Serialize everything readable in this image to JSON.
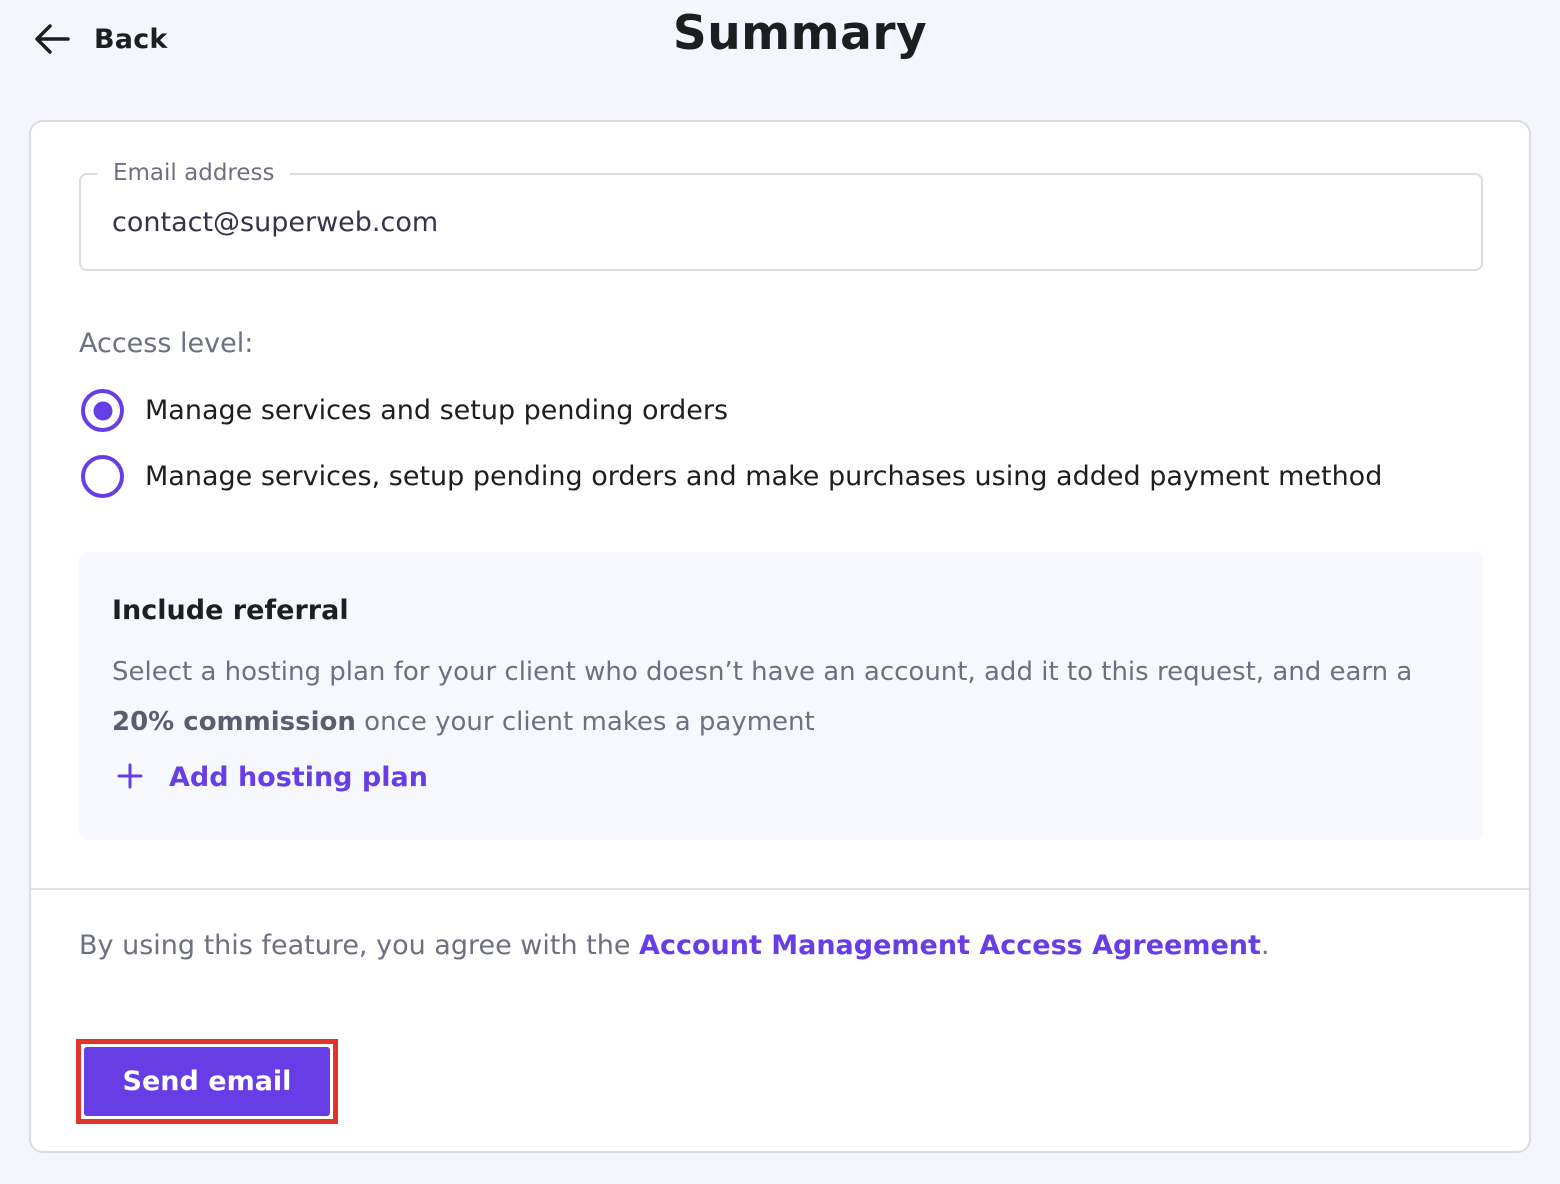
{
  "header": {
    "back_label": "Back",
    "title": "Summary"
  },
  "form": {
    "email": {
      "label": "Email address",
      "value": "contact@superweb.com"
    },
    "access": {
      "label": "Access level:",
      "options": [
        {
          "label": "Manage services and setup pending orders",
          "selected": true
        },
        {
          "label": "Manage services, setup pending orders and make purchases using added payment method",
          "selected": false
        }
      ]
    }
  },
  "referral": {
    "title": "Include referral",
    "text_before": "Select a hosting plan for your client who doesn’t have an account, add it to this request, and earn a ",
    "text_bold": "20% commission",
    "text_after": " once your client makes a payment",
    "add_label": "Add hosting plan"
  },
  "footer": {
    "agreement_prefix": "By using this feature, you agree with the ",
    "agreement_link": "Account Management Access Agreement",
    "agreement_suffix": ".",
    "send_label": "Send email"
  },
  "colors": {
    "accent": "#673de6",
    "highlight_border": "#e0352b",
    "background": "#f4f5fd"
  },
  "icons": {
    "back": "arrow-left-icon",
    "add": "plus-icon"
  }
}
